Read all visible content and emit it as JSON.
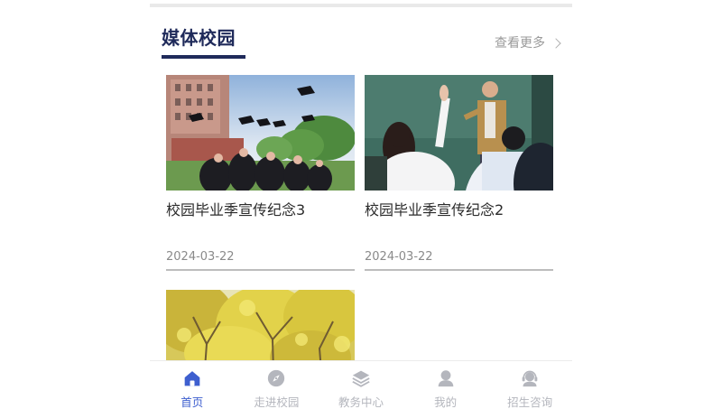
{
  "section": {
    "title": "媒体校园",
    "view_more": "查看更多",
    "accent_color": "#1f2a5a"
  },
  "cards": [
    {
      "title": "校园毕业季宣传纪念3",
      "date": "2024-03-22",
      "image": "graduation-caps-photo"
    },
    {
      "title": "校园毕业季宣传纪念2",
      "date": "2024-03-22",
      "image": "classroom-raised-hand-photo"
    },
    {
      "title": "",
      "date": "",
      "image": "ginkgo-trees-photo"
    }
  ],
  "tabbar": {
    "active_color": "#3e5fcf",
    "inactive_color": "#b4b6bd",
    "items": [
      {
        "label": "首页",
        "icon": "home-icon",
        "active": true
      },
      {
        "label": "走进校园",
        "icon": "compass-icon",
        "active": false
      },
      {
        "label": "教务中心",
        "icon": "layers-icon",
        "active": false
      },
      {
        "label": "我的",
        "icon": "user-icon",
        "active": false
      },
      {
        "label": "招生咨询",
        "icon": "headset-icon",
        "active": false
      }
    ]
  }
}
